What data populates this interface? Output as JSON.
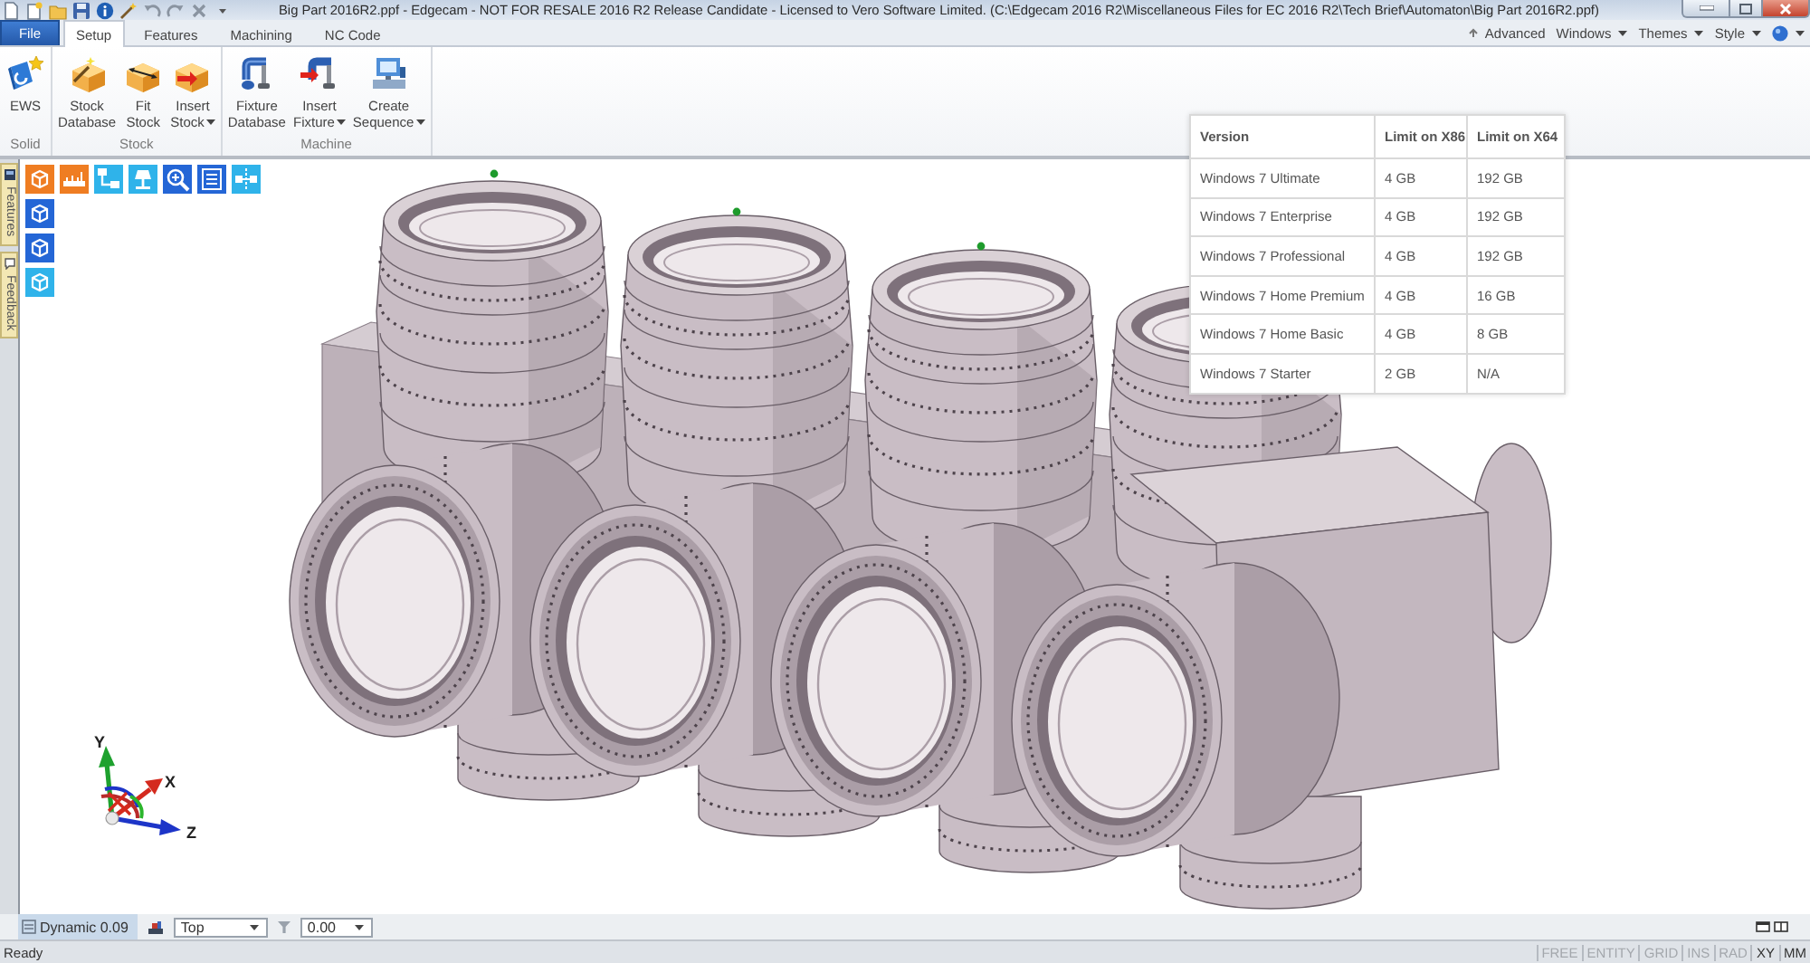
{
  "window": {
    "title": "Big Part 2016R2.ppf - Edgecam - NOT FOR RESALE 2016 R2 Release Candidate - Licensed to Vero Software Limited. (C:\\Edgecam 2016 R2\\Miscellaneous Files for EC 2016 R2\\Tech Brief\\Automaton\\Big Part 2016R2.ppf)"
  },
  "ribbon_tabs": [
    {
      "label": "File",
      "kind": "file",
      "selected": false
    },
    {
      "label": "Setup",
      "kind": "tab",
      "selected": true
    },
    {
      "label": "Features",
      "kind": "tab",
      "selected": false
    },
    {
      "label": "Machining",
      "kind": "tab",
      "selected": false
    },
    {
      "label": "NC Code",
      "kind": "tab",
      "selected": false
    }
  ],
  "ribbon_options": [
    {
      "label": "Advanced",
      "kind": "toggle"
    },
    {
      "label": "Windows",
      "kind": "menu"
    },
    {
      "label": "Themes",
      "kind": "menu"
    },
    {
      "label": "Style",
      "kind": "menu"
    }
  ],
  "ribbon_groups": [
    {
      "label": "Solid",
      "buttons": [
        {
          "label": "EWS",
          "dropdown": false
        }
      ]
    },
    {
      "label": "Stock",
      "buttons": [
        {
          "label": "Stock Database",
          "dropdown": false
        },
        {
          "label": "Fit Stock",
          "dropdown": false
        },
        {
          "label": "Insert Stock",
          "dropdown": true
        }
      ]
    },
    {
      "label": "Machine",
      "buttons": [
        {
          "label": "Fixture Database",
          "dropdown": false
        },
        {
          "label": "Insert Fixture",
          "dropdown": true
        },
        {
          "label": "Create Sequence",
          "dropdown": true
        }
      ]
    }
  ],
  "side_tabs": [
    {
      "label": "Features"
    },
    {
      "label": "Feedback"
    }
  ],
  "version_table": {
    "columns": [
      "Version",
      "Limit on X86",
      "Limit on X64"
    ],
    "rows": [
      [
        "Windows 7 Ultimate",
        "4 GB",
        "192 GB"
      ],
      [
        "Windows 7 Enterprise",
        "4 GB",
        "192 GB"
      ],
      [
        "Windows 7 Professional",
        "4 GB",
        "192 GB"
      ],
      [
        "Windows 7 Home Premium",
        "4 GB",
        "16 GB"
      ],
      [
        "Windows 7 Home Basic",
        "4 GB",
        "8 GB"
      ],
      [
        "Windows 7 Starter",
        "2 GB",
        "N/A"
      ]
    ]
  },
  "axis_triad": {
    "labels": [
      "Y",
      "X",
      "Z"
    ]
  },
  "view_bar": {
    "mode": "Dynamic 0.09",
    "view": "Top",
    "value": "0.00"
  },
  "status_bar": {
    "message": "Ready",
    "indicators": [
      {
        "label": "FREE",
        "on": false
      },
      {
        "label": "ENTITY",
        "on": false
      },
      {
        "label": "GRID",
        "on": false
      },
      {
        "label": "INS",
        "on": false
      },
      {
        "label": "RAD",
        "on": false
      },
      {
        "label": "XY",
        "on": true
      },
      {
        "label": "MM",
        "on": true
      }
    ]
  }
}
